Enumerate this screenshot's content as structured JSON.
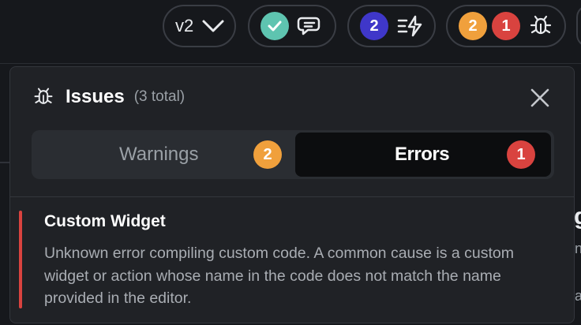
{
  "toolbar": {
    "version_label": "v2",
    "chat_badge_icon": "check-icon",
    "actions_count": "2",
    "warnings_count": "2",
    "errors_count": "1"
  },
  "issues_panel": {
    "title": "Issues",
    "count_text": "(3 total)",
    "tabs": [
      {
        "label": "Warnings",
        "count": "2",
        "active": false
      },
      {
        "label": "Errors",
        "count": "1",
        "active": true
      }
    ],
    "items": [
      {
        "title": "Custom Widget",
        "message": "Unknown error compiling custom code. A common cause is a custom widget or action whose name in the code does not match the name provided in the editor.",
        "severity": "error"
      }
    ]
  },
  "colors": {
    "background": "#16181c",
    "panel": "#202226",
    "error": "#d9433f",
    "warning": "#f0a03c",
    "success": "#5ec4b0",
    "accent": "#3f37c9"
  }
}
